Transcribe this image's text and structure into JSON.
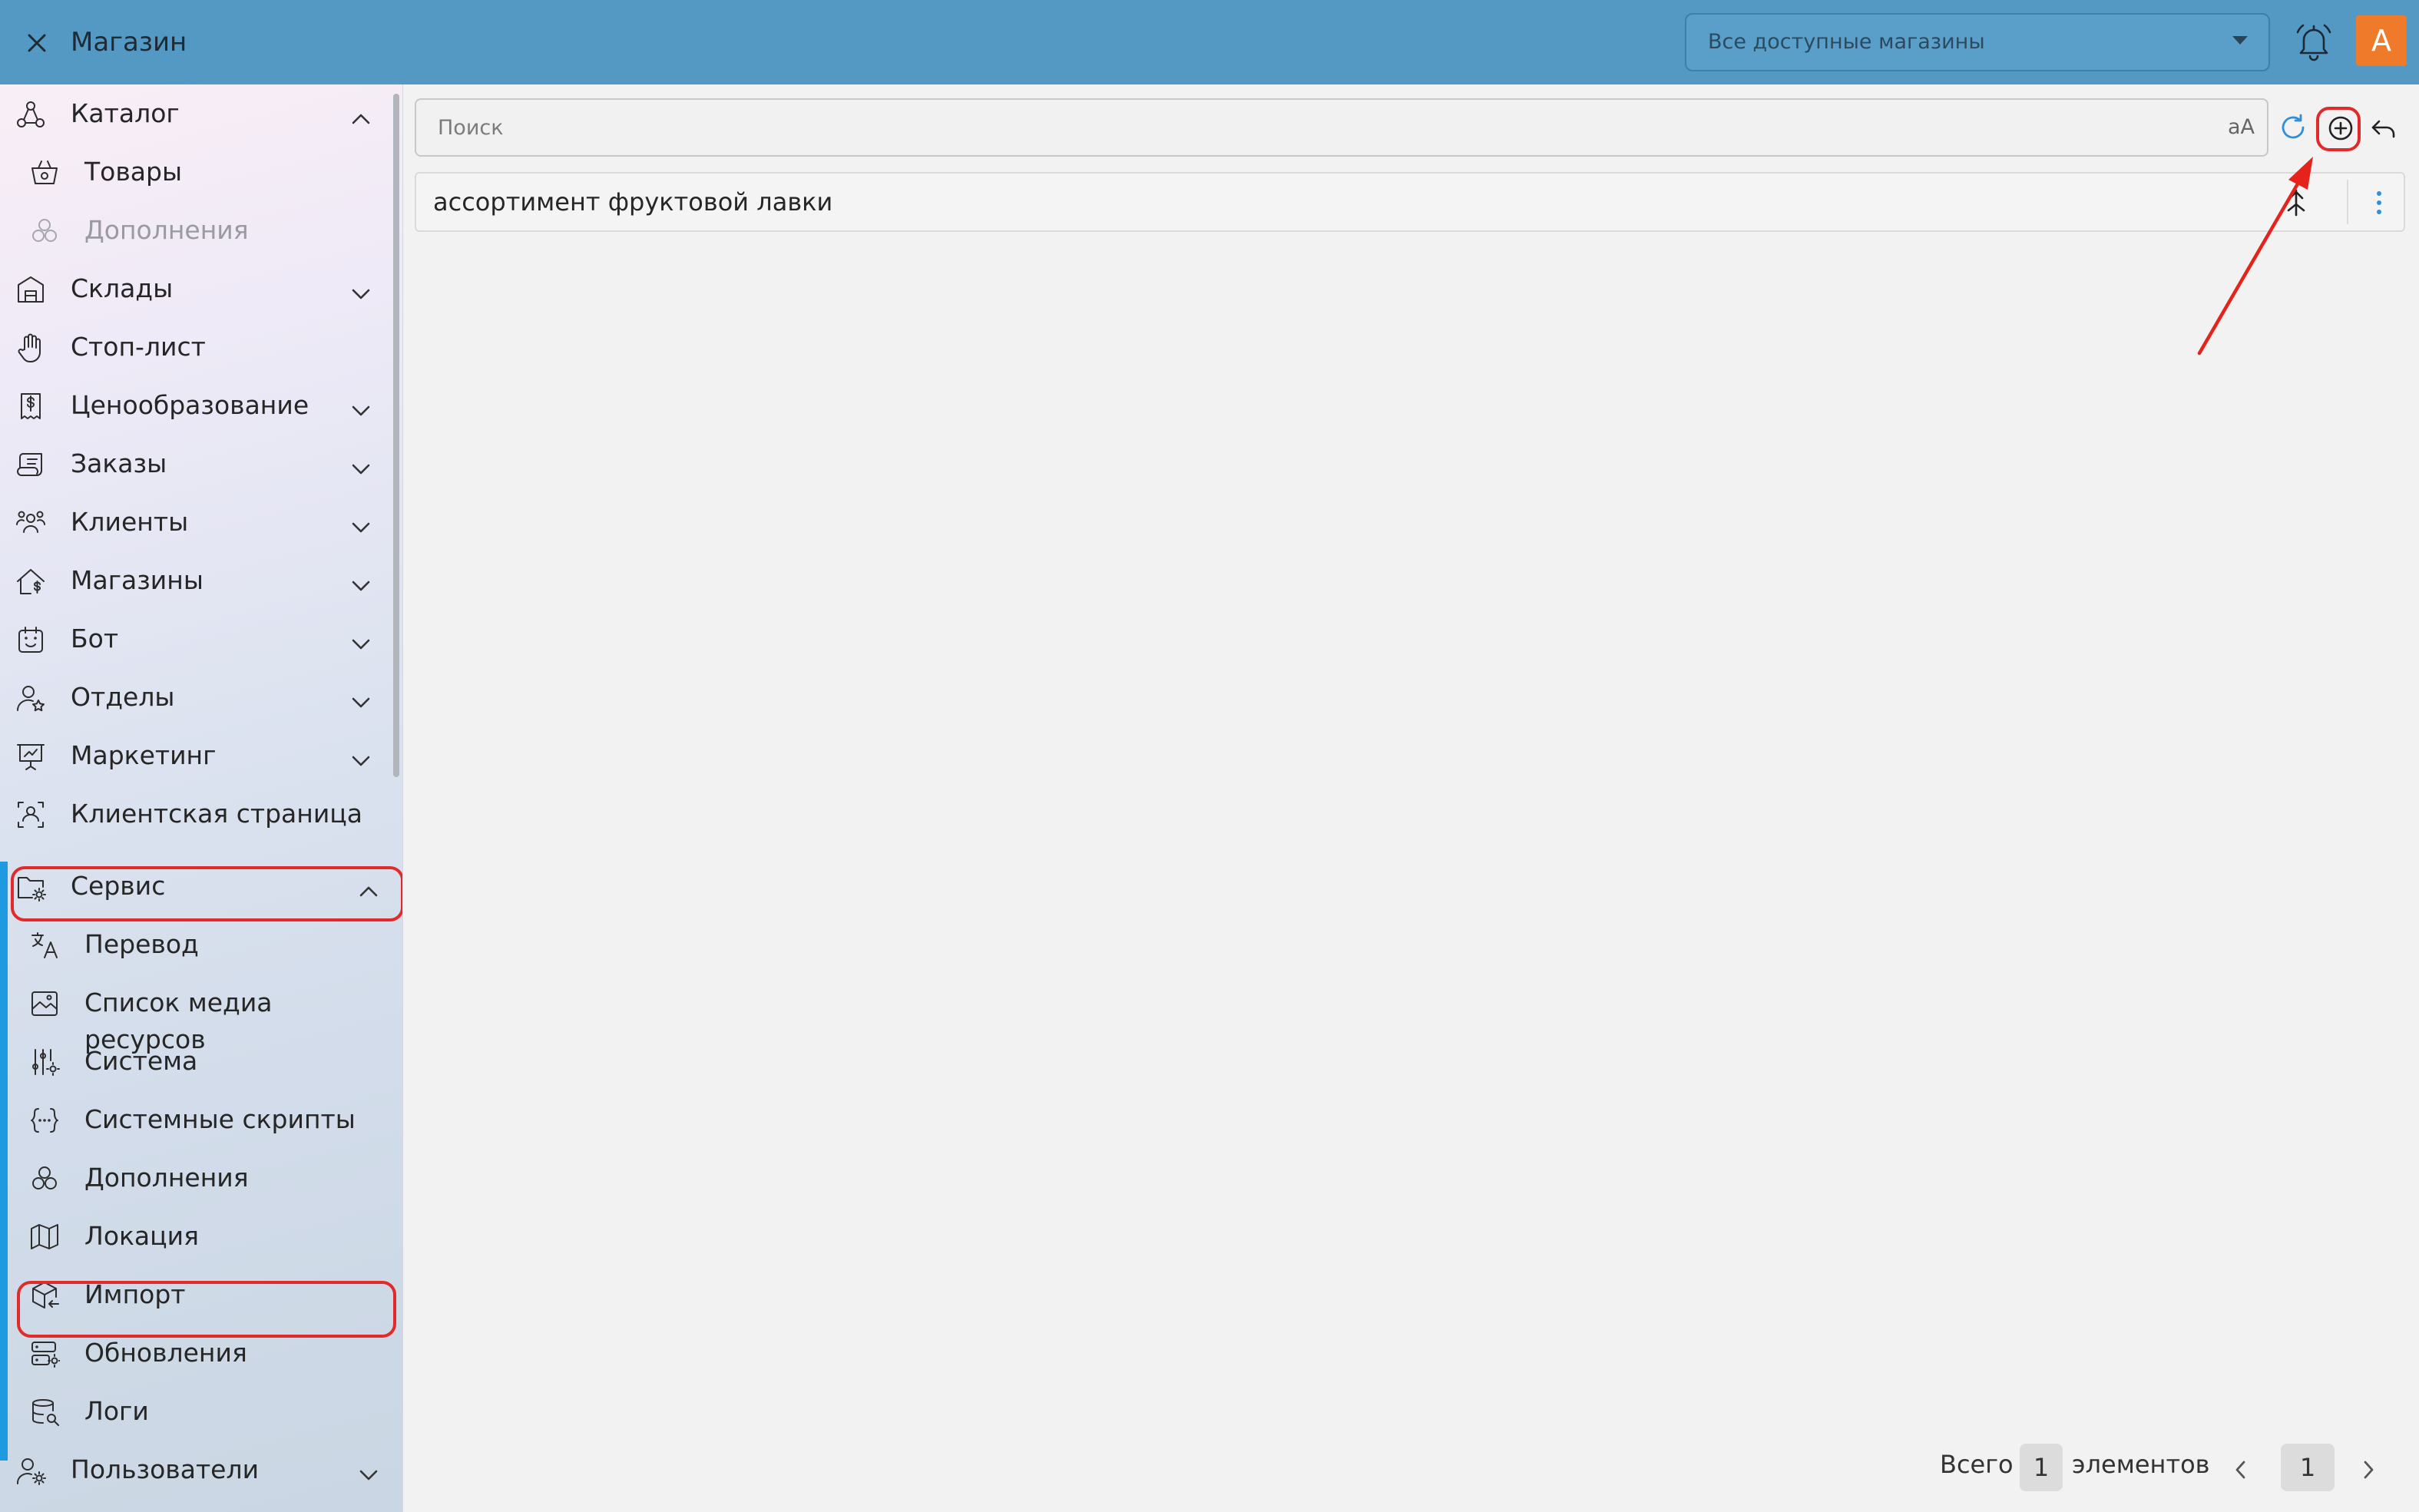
{
  "header": {
    "title": "Магазин",
    "store_select": {
      "value": "Все доступные магазины"
    },
    "avatar_letter": "А",
    "colors": {
      "bar": "#5499c4",
      "avatar": "#ef7b2a"
    }
  },
  "sidebar": {
    "top_items": [
      {
        "label": "Каталог",
        "icon": "catalog-icon",
        "expanded": true
      },
      {
        "label": "Склады",
        "icon": "warehouse-icon"
      },
      {
        "label": "Стоп-лист",
        "icon": "hand-stop-icon"
      },
      {
        "label": "Ценообразование",
        "icon": "price-receipt-icon"
      },
      {
        "label": "Заказы",
        "icon": "orders-icon"
      },
      {
        "label": "Клиенты",
        "icon": "clients-icon"
      },
      {
        "label": "Магазины",
        "icon": "stores-icon"
      },
      {
        "label": "Бот",
        "icon": "bot-icon"
      },
      {
        "label": "Отделы",
        "icon": "departments-icon"
      },
      {
        "label": "Маркетинг",
        "icon": "marketing-icon"
      },
      {
        "label": "Клиентская страница",
        "icon": "client-page-icon"
      },
      {
        "label": "Сервис",
        "icon": "service-folder-icon",
        "expanded": true
      },
      {
        "label": "Пользователи",
        "icon": "users-settings-icon"
      }
    ],
    "catalog_children": [
      {
        "label": "Товары",
        "icon": "basket-icon"
      },
      {
        "label": "Дополнения",
        "icon": "addons-icon",
        "disabled": true
      }
    ],
    "service_children": [
      {
        "label": "Перевод",
        "icon": "translate-icon"
      },
      {
        "label": "Список медиа ресурсов",
        "icon": "media-icon"
      },
      {
        "label": "Система",
        "icon": "sliders-icon"
      },
      {
        "label": "Системные скрипты",
        "icon": "scripts-icon"
      },
      {
        "label": "Дополнения",
        "icon": "addons-icon"
      },
      {
        "label": "Локация",
        "icon": "map-icon"
      },
      {
        "label": "Импорт",
        "icon": "import-box-icon",
        "highlighted": true
      },
      {
        "label": "Обновления",
        "icon": "updates-server-icon"
      },
      {
        "label": "Логи",
        "icon": "logs-database-icon"
      }
    ],
    "highlight_color": "#e12b2b",
    "accent_color": "#1e9be0"
  },
  "search": {
    "placeholder": "Поиск",
    "case_toggle": "aA"
  },
  "list": {
    "rows": [
      {
        "title": "ассортимент фруктовой лавки"
      }
    ]
  },
  "pagination": {
    "label": "Всего",
    "count": "1",
    "suffix": "элементов",
    "page": "1"
  },
  "annotation": {
    "arrow_color": "#e5231b",
    "target": "add-button"
  }
}
